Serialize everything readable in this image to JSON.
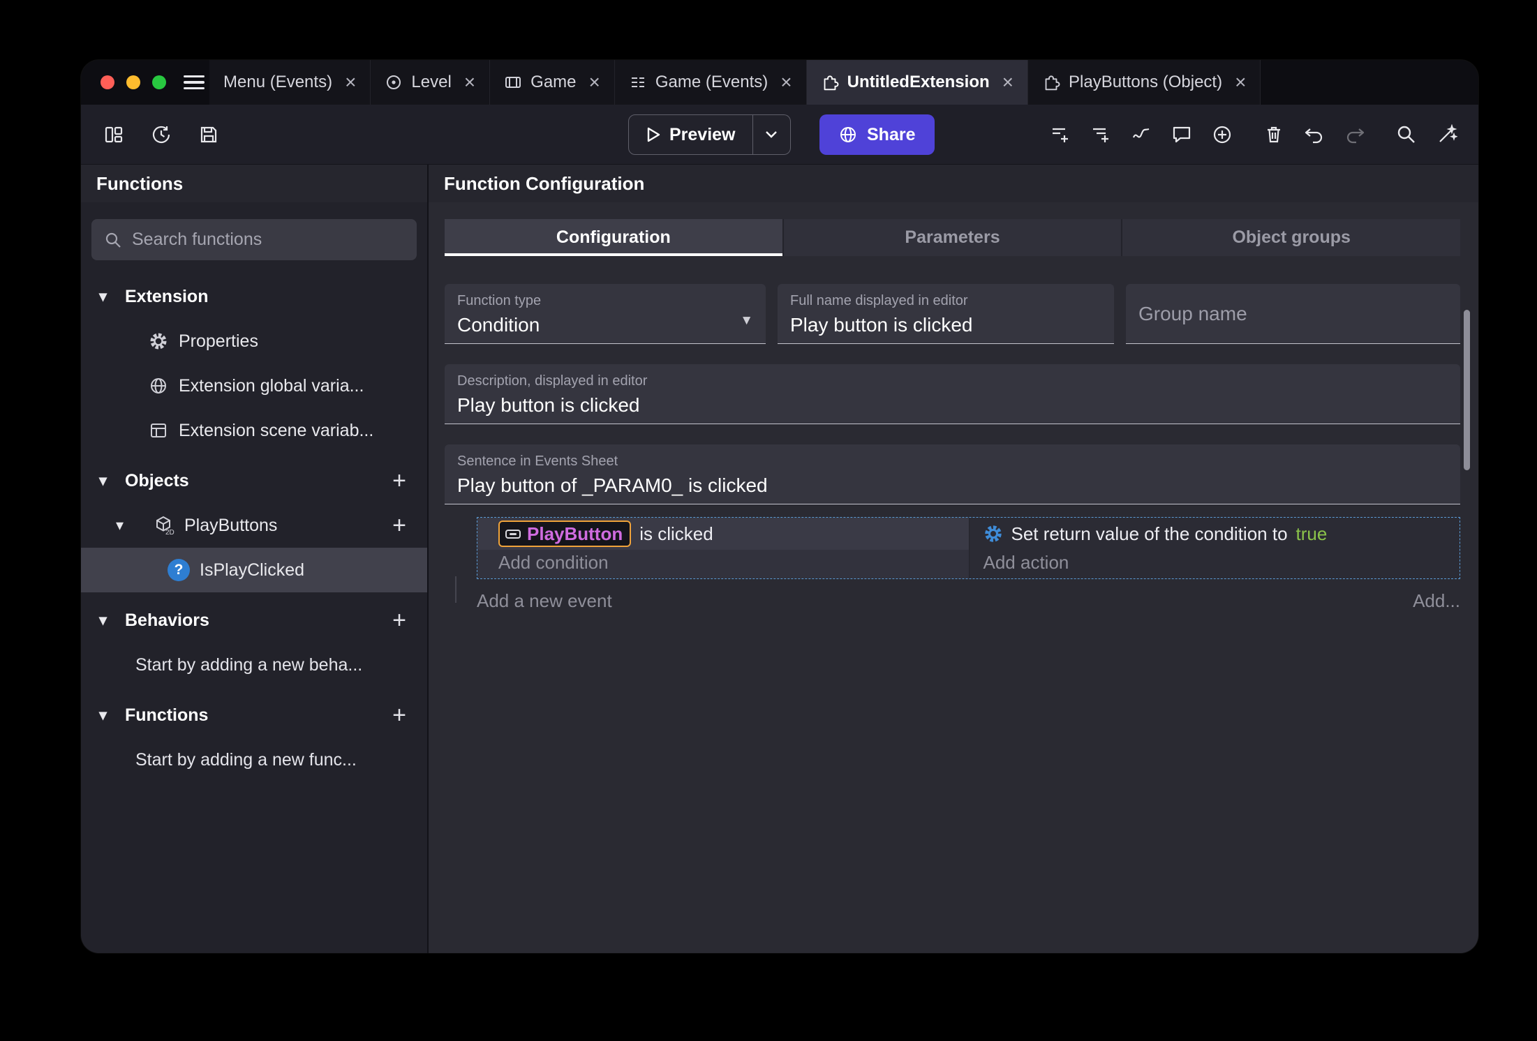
{
  "window": {
    "close_glyph": "×"
  },
  "tabs": [
    {
      "label": "Menu (Events)"
    },
    {
      "label": "Level"
    },
    {
      "label": "Game"
    },
    {
      "label": "Game (Events)"
    },
    {
      "label": "UntitledExtension",
      "active": true
    },
    {
      "label": "PlayButtons (Object)"
    }
  ],
  "toolbar": {
    "preview": "Preview",
    "share": "Share"
  },
  "sidebar": {
    "title": "Functions",
    "search_placeholder": "Search functions",
    "sections": {
      "extension": {
        "label": "Extension",
        "items": [
          {
            "label": "Properties"
          },
          {
            "label": "Extension global varia..."
          },
          {
            "label": "Extension scene variab..."
          }
        ]
      },
      "objects": {
        "label": "Objects",
        "object": {
          "label": "PlayButtons",
          "badge": "2D",
          "child": {
            "label": "IsPlayClicked",
            "glyph": "?"
          }
        }
      },
      "behaviors": {
        "label": "Behaviors",
        "hint": "Start by adding a new beha..."
      },
      "functions": {
        "label": "Functions",
        "hint": "Start by adding a new func..."
      }
    }
  },
  "main": {
    "title": "Function Configuration",
    "tabs": [
      {
        "label": "Configuration",
        "active": true
      },
      {
        "label": "Parameters"
      },
      {
        "label": "Object groups"
      }
    ],
    "form": {
      "function_type_label": "Function type",
      "function_type_value": "Condition",
      "full_name_label": "Full name displayed in editor",
      "full_name_value": "Play button is clicked",
      "group_name_label": "Group name",
      "description_label": "Description, displayed in editor",
      "description_value": "Play button is clicked",
      "sentence_label": "Sentence in Events Sheet",
      "sentence_value": "Play button of _PARAM0_ is clicked"
    },
    "events": {
      "condition_object": "PlayButton",
      "condition_text": "is clicked",
      "add_condition": "Add condition",
      "action_text": "Set return value of the condition to",
      "action_value": "true",
      "add_action": "Add action",
      "add_event": "Add a new event",
      "add_more": "Add..."
    }
  },
  "colors": {
    "share_accent": "#4f42d8",
    "chip_border": "#f0a33a",
    "chip_text": "#d06ce0",
    "true_green": "#8bc34a",
    "gear_blue": "#3f8cd8",
    "selection_blue": "#5b9bd5"
  }
}
